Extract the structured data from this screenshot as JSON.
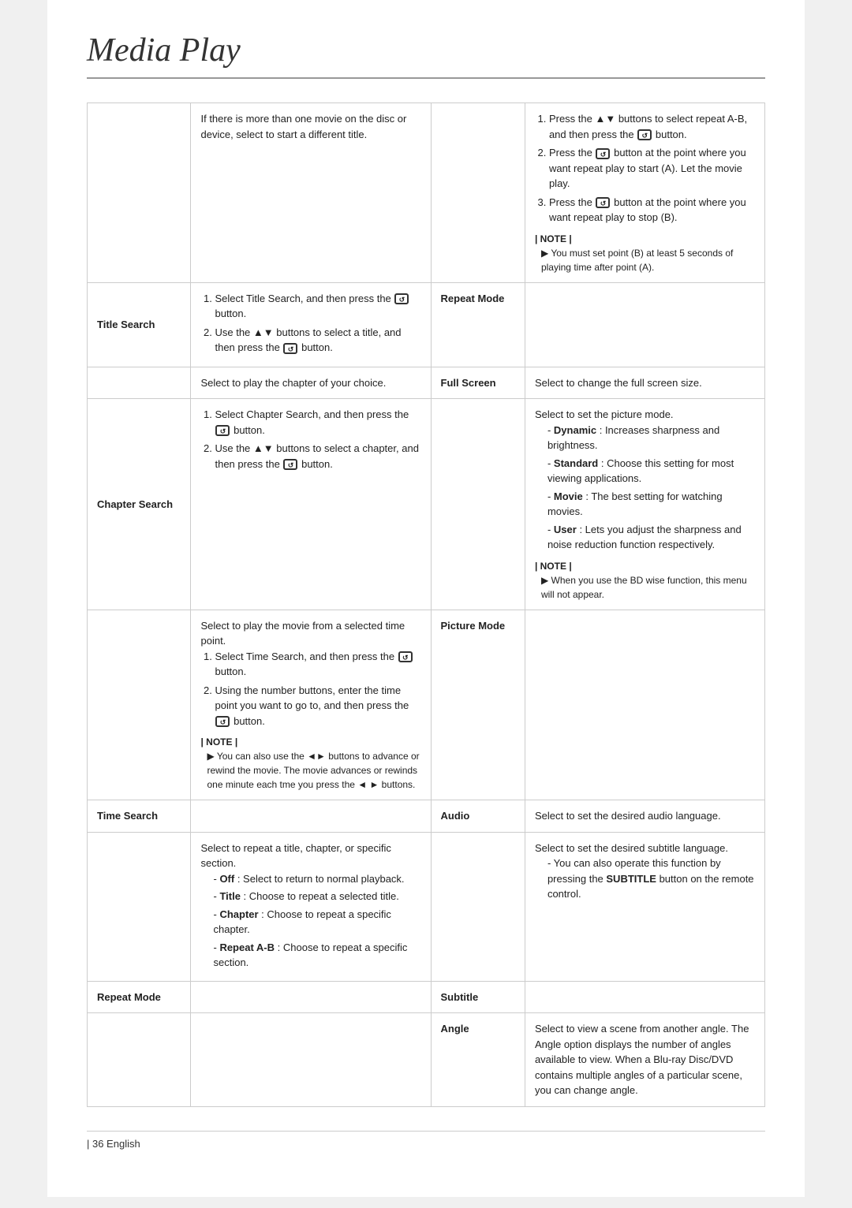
{
  "page": {
    "title": "Media Play",
    "footer": "| 36  English"
  },
  "left_table": [
    {
      "label": "",
      "label_empty": true,
      "content_html": "If there is more than one movie on the disc or device, select to start a different title."
    },
    {
      "label": "Title Search",
      "content_html": "<ol><li>Select Title Search, and then press the <span class='inline-icon'>&#x21BA;</span> button.</li><li>Use the ▲▼ buttons to select a title, and then press the <span class='inline-icon'>&#x21BA;</span> button.</li></ol>"
    },
    {
      "label": "",
      "label_empty": true,
      "content_html": "Select to play the chapter of your choice."
    },
    {
      "label": "Chapter Search",
      "content_html": "<ol><li>Select Chapter Search, and then press the <span class='inline-icon'>&#x21BA;</span> button.</li><li>Use the ▲▼ buttons to select a chapter, and then press the <span class='inline-icon'>&#x21BA;</span> button.</li></ol>"
    },
    {
      "label": "",
      "label_empty": true,
      "content_html": "Select to play the movie from a selected time point.<ol><li>Select Time Search, and then press the <span class='inline-icon'>&#x21BA;</span> button.</li><li>Using the number buttons, enter the time point you want to go to, and then press the <span class='inline-icon'>&#x21BA;</span> button.</li></ol><div class='note-block'><div class='note-title'>| NOTE |</div><div class='note-item'>You can also use the ◄► buttons to advance or rewind the movie. The movie advances or rewinds one minute each tme you press the ◄ ► buttons.</div></div>"
    },
    {
      "label": "Time Search",
      "label_only": true
    },
    {
      "label": "",
      "label_empty": true,
      "content_html": "Select to repeat a title, chapter, or specific section.<ul><li><span class='bold'>Off</span> : Select to return to normal playback.</li><li><span class='bold'>Title</span> : Choose to repeat a selected title.</li><li><span class='bold'>Chapter</span> : Choose to repeat a specific chapter.</li><li><span class='bold'>Repeat A-B</span> : Choose to repeat a specific section.</li></ul>"
    },
    {
      "label": "Repeat Mode",
      "label_only": true
    }
  ],
  "right_table": [
    {
      "label": "",
      "label_empty": true,
      "content_html": "<ol><li>Press the ▲▼ buttons to select repeat A-B, and then press the <span class='inline-icon'>&#x21BA;</span> button.</li><li>Press the <span class='inline-icon'>&#x21BA;</span> button at the point where you want repeat play to start (A). Let the movie play.</li><li>Press the <span class='inline-icon'>&#x21BA;</span> button at the point where you want repeat play to stop (B).</li></ol><div class='note-block'><div class='note-title'>| NOTE |</div><div class='note-item'>You must set point (B) at least 5 seconds of playing time after point (A).</div></div>"
    },
    {
      "label": "Repeat Mode",
      "label_only": true
    },
    {
      "label": "Full Screen",
      "content_html": "Select to change the full screen size."
    },
    {
      "label": "",
      "label_empty": true,
      "content_html": "Select to set the picture mode.<ul><li><span class='bold'>Dynamic</span> : Increases sharpness and brightness.</li><li><span class='bold'>Standard</span> : Choose this setting for most viewing applications.</li><li><span class='bold'>Movie</span> : The best setting for watching movies.</li><li><span class='bold'>User</span> : Lets you adjust the sharpness and noise reduction function respectively.</li></ul><div class='note-block'><div class='note-title'>| NOTE |</div><div class='note-item'>When you use the BD wise function, this menu will not appear.</div></div>"
    },
    {
      "label": "Picture Mode",
      "label_only": true
    },
    {
      "label": "Audio",
      "content_html": "Select to set the desired audio language."
    },
    {
      "label": "",
      "label_empty": true,
      "content_html": "Select to set the desired subtitle language.<ul><li>You can also operate this function by pressing the <span class='bold'>SUBTITLE</span> button on the remote control.</li></ul>"
    },
    {
      "label": "Subtitle",
      "label_only": true
    },
    {
      "label": "Angle",
      "content_html": "Select to view a scene from another angle. The Angle option displays the number of angles available to view. When a Blu-ray Disc/DVD contains multiple angles of a particular scene, you can change angle."
    }
  ]
}
